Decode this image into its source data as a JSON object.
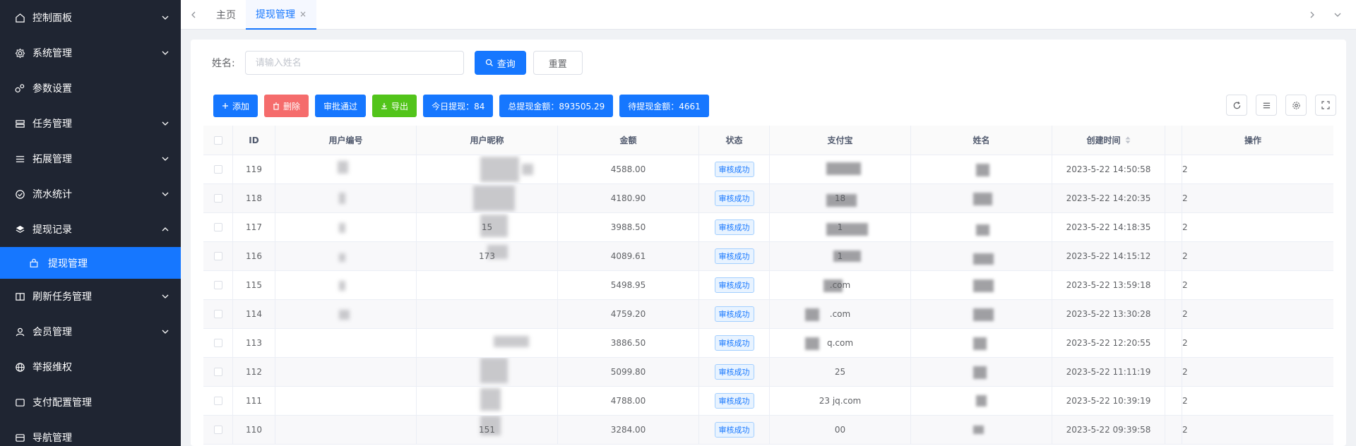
{
  "sidebar": {
    "items": [
      {
        "label": "控制面板",
        "icon": "home-icon",
        "expand": "down"
      },
      {
        "label": "系统管理",
        "icon": "gear-icon",
        "expand": "down"
      },
      {
        "label": "参数设置",
        "icon": "gears-icon",
        "expand": ""
      },
      {
        "label": "任务管理",
        "icon": "server-icon",
        "expand": "down"
      },
      {
        "label": "拓展管理",
        "icon": "list-icon",
        "expand": "down"
      },
      {
        "label": "流水统计",
        "icon": "check-circle-icon",
        "expand": "down"
      },
      {
        "label": "提现记录",
        "icon": "layers-icon",
        "expand": "up"
      },
      {
        "label": "提现管理",
        "icon": "bag-icon",
        "expand": "",
        "sub": true
      },
      {
        "label": "刷新任务管理",
        "icon": "book-icon",
        "expand": "down"
      },
      {
        "label": "会员管理",
        "icon": "user-icon",
        "expand": "down"
      },
      {
        "label": "举报维权",
        "icon": "globe-icon",
        "expand": ""
      },
      {
        "label": "支付配置管理",
        "icon": "window-icon",
        "expand": ""
      },
      {
        "label": "导航管理",
        "icon": "nav-icon",
        "expand": ""
      }
    ]
  },
  "tabs": [
    {
      "label": "主页",
      "active": false
    },
    {
      "label": "提现管理",
      "active": true,
      "close": "×"
    }
  ],
  "search": {
    "label": "姓名:",
    "placeholder": "请输入姓名",
    "query_label": "查询",
    "reset_label": "重置"
  },
  "toolbar": {
    "add_label": "添加",
    "delete_label": "删除",
    "approve_label": "审批通过",
    "export_label": "导出",
    "today_label": "今日提现：84",
    "total_label": "总提现金额：893505.29",
    "pending_label": "待提现金额：4661"
  },
  "table": {
    "columns": [
      "ID",
      "用户编号",
      "用户昵称",
      "金额",
      "状态",
      "支付宝",
      "姓名",
      "创建时间",
      "操作"
    ],
    "rows": [
      {
        "id": "119",
        "nick": "",
        "amount": "4588.00",
        "status": "审核成功",
        "alipay": "",
        "name": "",
        "time": "2023-5-22 14:50:58",
        "op": "2"
      },
      {
        "id": "118",
        "nick": "",
        "amount": "4180.90",
        "status": "审核成功",
        "alipay": "18",
        "name": "",
        "time": "2023-5-22 14:20:35",
        "op": "2"
      },
      {
        "id": "117",
        "nick": "15",
        "amount": "3988.50",
        "status": "审核成功",
        "alipay": "1",
        "name": "",
        "time": "2023-5-22 14:18:35",
        "op": "2"
      },
      {
        "id": "116",
        "nick": "173",
        "amount": "4089.61",
        "status": "审核成功",
        "alipay": "1",
        "name": "",
        "time": "2023-5-22 14:15:12",
        "op": "2"
      },
      {
        "id": "115",
        "nick": "",
        "amount": "5498.95",
        "status": "审核成功",
        "alipay": ".com",
        "name": "",
        "time": "2023-5-22 13:59:18",
        "op": "2"
      },
      {
        "id": "114",
        "nick": "",
        "amount": "4759.20",
        "status": "审核成功",
        "alipay": ".com",
        "name": "",
        "time": "2023-5-22 13:30:28",
        "op": "2"
      },
      {
        "id": "113",
        "nick": "",
        "amount": "3886.50",
        "status": "审核成功",
        "alipay": "q.com",
        "name": "",
        "time": "2023-5-22 12:20:55",
        "op": "2"
      },
      {
        "id": "112",
        "nick": "",
        "amount": "5099.80",
        "status": "审核成功",
        "alipay": "25",
        "name": "",
        "time": "2023-5-22 11:11:19",
        "op": "2"
      },
      {
        "id": "111",
        "nick": "",
        "amount": "4788.00",
        "status": "审核成功",
        "alipay": "23        jq.com",
        "name": "",
        "time": "2023-5-22 10:39:19",
        "op": "2"
      },
      {
        "id": "110",
        "nick": "151",
        "amount": "3284.00",
        "status": "审核成功",
        "alipay": "00",
        "name": "",
        "time": "2023-5-22 09:39:58",
        "op": "2"
      }
    ]
  },
  "colors": {
    "sidebar_bg": "#1f2532",
    "accent": "#1677ff",
    "danger": "#f56c6c",
    "success": "#52c41a"
  }
}
